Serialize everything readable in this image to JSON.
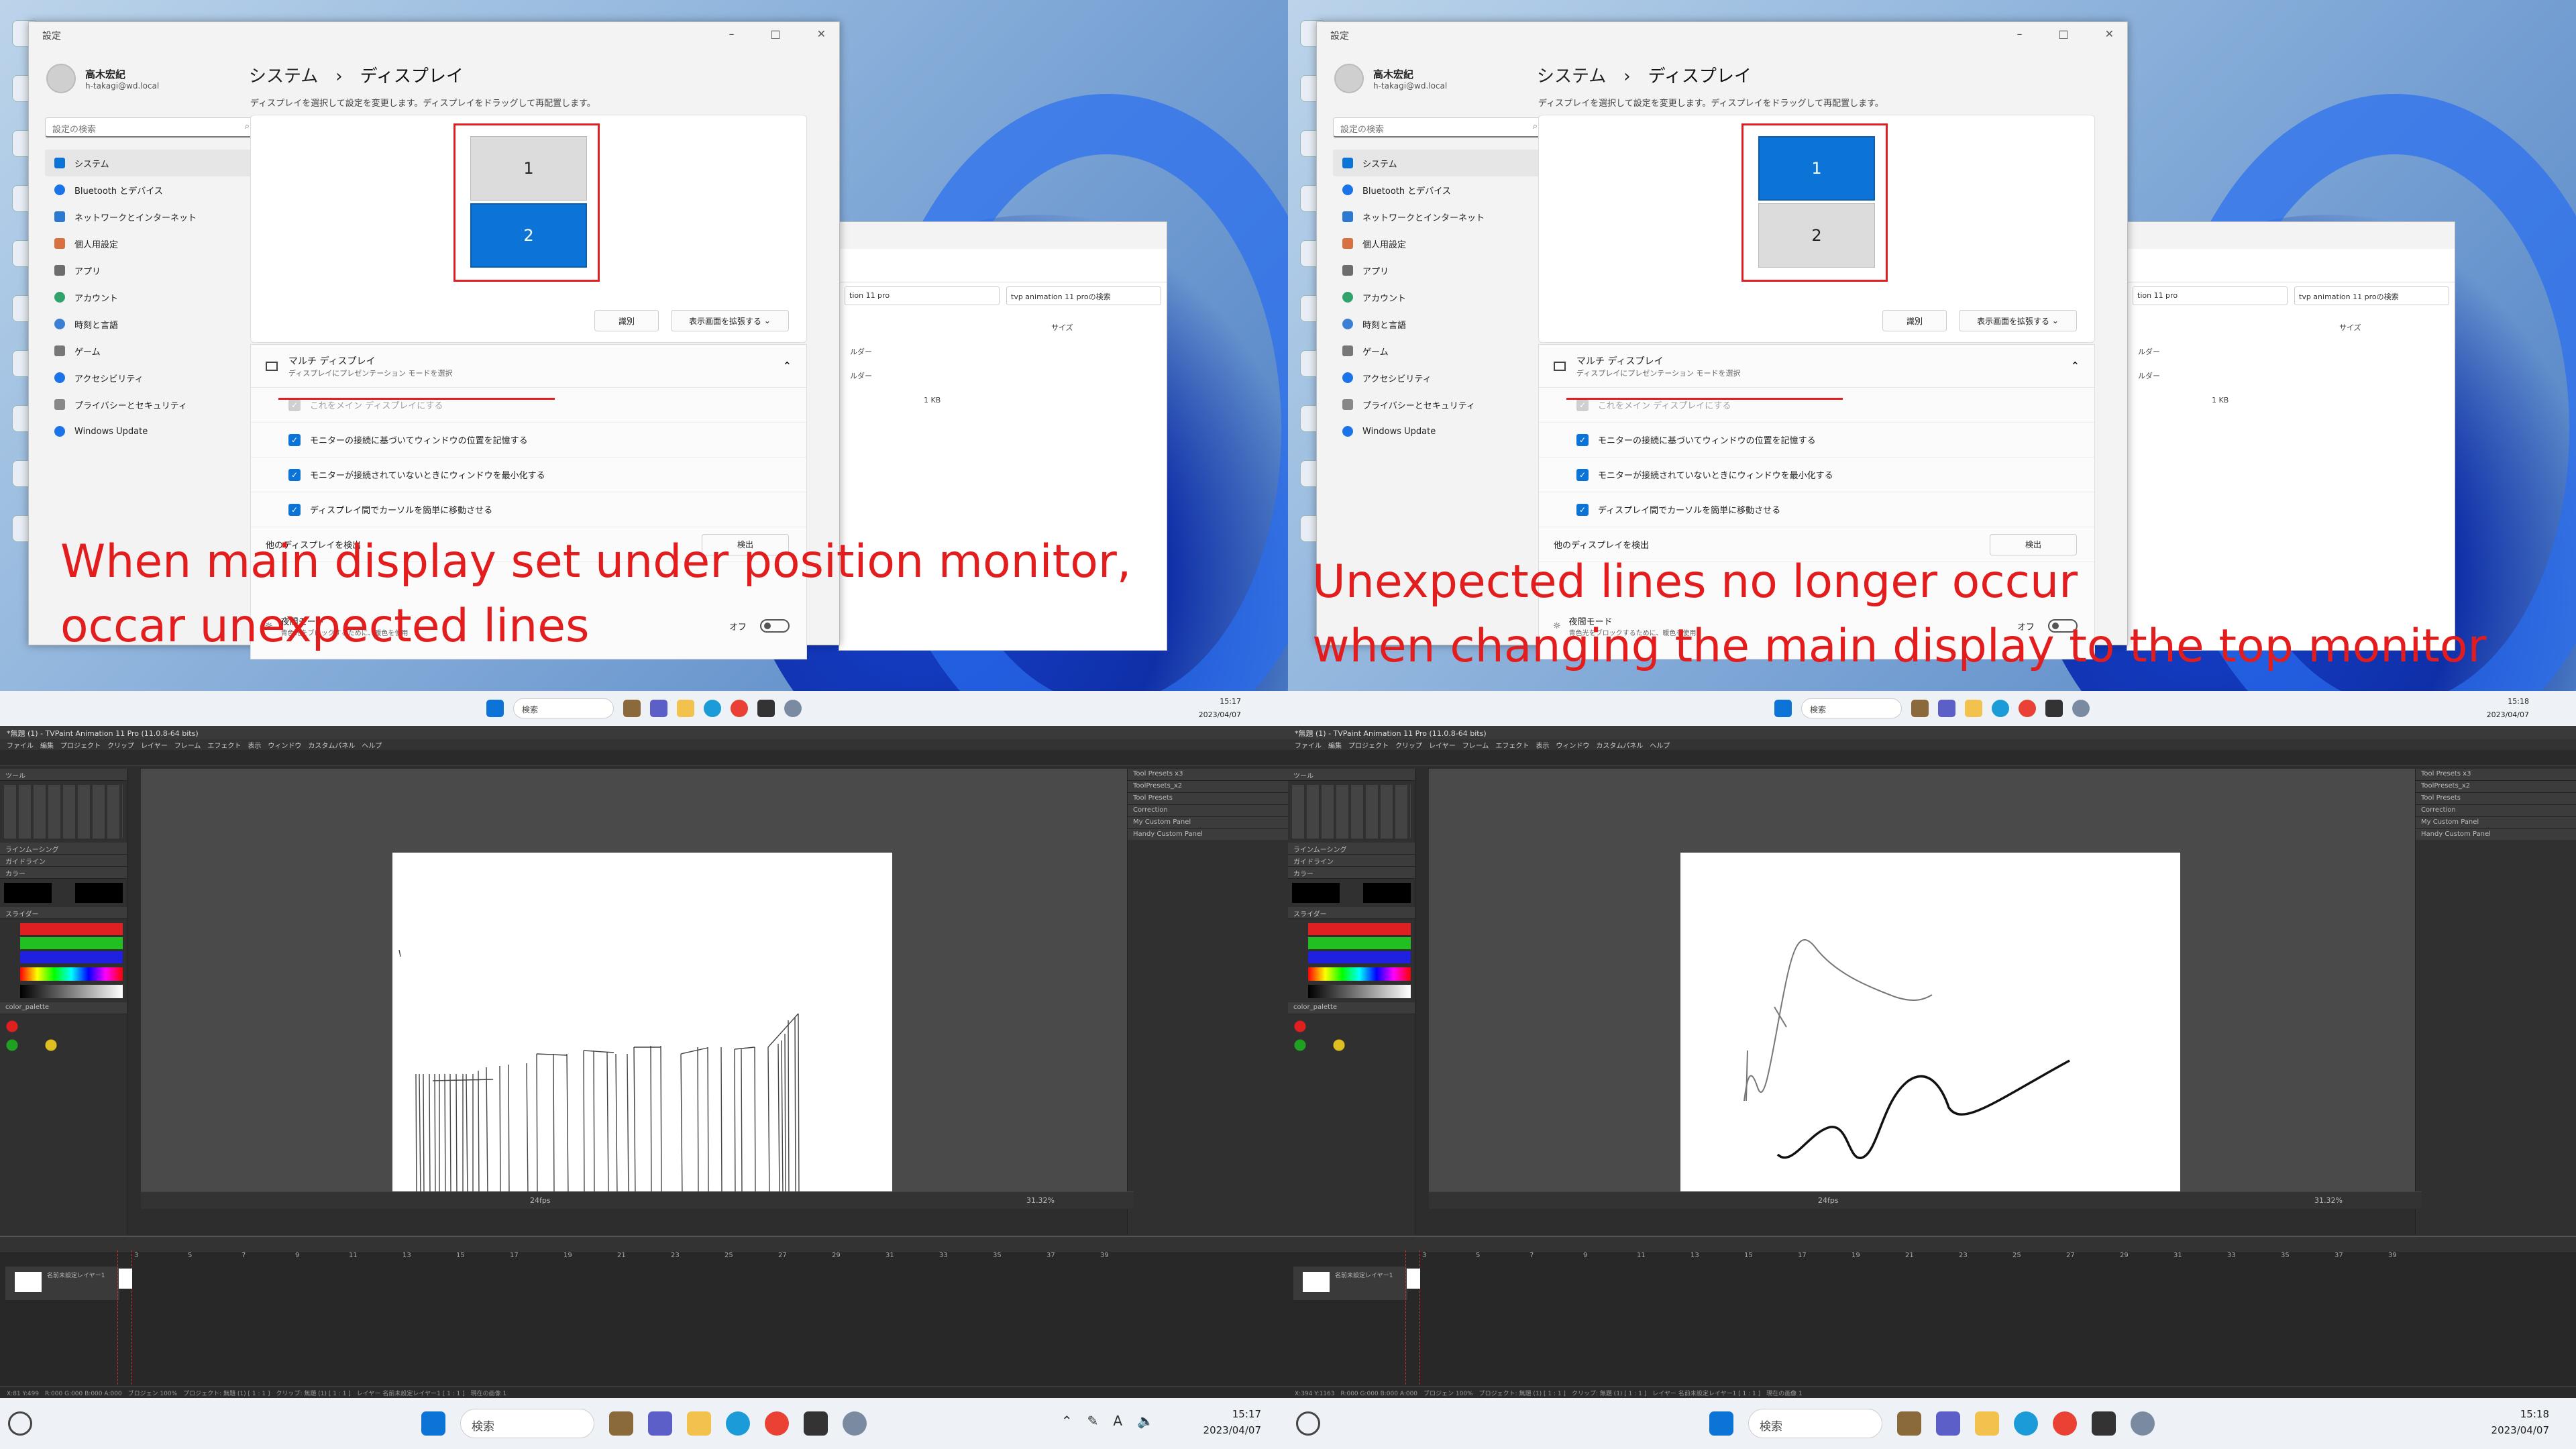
{
  "colors": {
    "accent": "#0b74d6",
    "annotation_red": "#e31d1d",
    "canvas_bg": "#ffffff",
    "app_bg": "#2d2d2d"
  },
  "panels": [
    {
      "id": "left",
      "settings": {
        "window_title": "設定",
        "user_name": "高木宏紀",
        "user_email": "h-takagi@wd.local",
        "search_placeholder": "設定の検索",
        "breadcrumb_parent": "システム",
        "breadcrumb_current": "ディスプレイ",
        "description": "ディスプレイを選択して設定を変更します。ディスプレイをドラッグして再配置します。",
        "monitor_top_label": "1",
        "monitor_bottom_label": "2",
        "selected_monitor": "bottom",
        "identify_button": "識別",
        "extend_dropdown": "表示画面を拡張する",
        "multi_title": "マルチ ディスプレイ",
        "multi_subtitle": "ディスプレイにプレゼンテーション モードを選択",
        "main_display_checkbox": "これをメイン ディスプレイにする",
        "remember_checkbox": "モニターの接続に基づいてウィンドウの位置を記憶する",
        "minimize_checkbox": "モニターが接続されていないときにウィンドウを最小化する",
        "cursor_checkbox": "ディスプレイ間でカーソルを簡単に移動させる",
        "detect_label": "他のディスプレイを検出",
        "detect_button": "検出",
        "night_title": "夜間モード",
        "night_subtitle": "青色光をブロックするために、暖色を使用",
        "night_value": "オフ",
        "nav": [
          "システム",
          "Bluetooth とデバイス",
          "ネットワークとインターネット",
          "個人用設定",
          "アプリ",
          "アカウント",
          "時刻と言語",
          "ゲーム",
          "アクセシビリティ",
          "プライバシーとセキュリティ",
          "Windows Update"
        ]
      },
      "explorer": {
        "address": "tion 11 pro",
        "search": "tvp animation 11 proの検索",
        "col_size": "サイズ",
        "rows": [
          "ルダー",
          "ルダー",
          "1 KB"
        ]
      },
      "caption_line1": "When main display set under position monitor,",
      "caption_line2": "occar unexpected lines",
      "taskbar_top": {
        "search": "検索",
        "time": "15:17",
        "date": "2023/04/07"
      },
      "tvpaint": {
        "title": "*無題 (1) - TVPaint Animation 11 Pro (11.0.8-64 bits)",
        "menu": "ファイル　編集　プロジェクト　クリップ　レイヤー　フレーム　エフェクト　表示　ウィンドウ　カスタムパネル　ヘルプ",
        "zoom": "31.32%",
        "fps": "24fps",
        "status": "X:81 Y:499　R:000 G:000 B:000 A:000　ブロジェン 100%　プロジェクト: 無題 (1) [ 1 : 1 ]　クリップ: 無題 (1) [ 1 : 1 ]　レイヤー 名前未設定レイヤー1 [ 1 : 1 ]　現在の画像 1",
        "layer_name": "名前未設定レイヤー1",
        "panel_header": "Tool Presets x3"
      },
      "taskbar_bottom": {
        "search": "検索",
        "time": "15:17",
        "date": "2023/04/07"
      }
    },
    {
      "id": "right",
      "settings": {
        "window_title": "設定",
        "user_name": "高木宏紀",
        "user_email": "h-takagi@wd.local",
        "search_placeholder": "設定の検索",
        "breadcrumb_parent": "システム",
        "breadcrumb_current": "ディスプレイ",
        "description": "ディスプレイを選択して設定を変更します。ディスプレイをドラッグして再配置します。",
        "monitor_top_label": "1",
        "monitor_bottom_label": "2",
        "selected_monitor": "top",
        "identify_button": "識別",
        "extend_dropdown": "表示画面を拡張する",
        "multi_title": "マルチ ディスプレイ",
        "multi_subtitle": "ディスプレイにプレゼンテーション モードを選択",
        "main_display_checkbox": "これをメイン ディスプレイにする",
        "remember_checkbox": "モニターの接続に基づいてウィンドウの位置を記憶する",
        "minimize_checkbox": "モニターが接続されていないときにウィンドウを最小化する",
        "cursor_checkbox": "ディスプレイ間でカーソルを簡単に移動させる",
        "detect_label": "他のディスプレイを検出",
        "detect_button": "検出",
        "night_title": "夜間モード",
        "night_subtitle": "青色光をブロックするために、暖色を使用",
        "night_value": "オフ",
        "nav": [
          "システム",
          "Bluetooth とデバイス",
          "ネットワークとインターネット",
          "個人用設定",
          "アプリ",
          "アカウント",
          "時刻と言語",
          "ゲーム",
          "アクセシビリティ",
          "プライバシーとセキュリティ",
          "Windows Update"
        ]
      },
      "explorer": {
        "address": "tion 11 pro",
        "search": "tvp animation 11 proの検索",
        "col_size": "サイズ",
        "rows": [
          "ルダー",
          "ルダー",
          "1 KB"
        ]
      },
      "caption_line1": "Unexpected lines no longer occur",
      "caption_line2": "when changing the main display to the top monitor",
      "taskbar_top": {
        "search": "検索",
        "time": "15:18",
        "date": "2023/04/07"
      },
      "tvpaint": {
        "title": "*無題 (1) - TVPaint Animation 11 Pro (11.0.8-64 bits)",
        "menu": "ファイル　編集　プロジェクト　クリップ　レイヤー　フレーム　エフェクト　表示　ウィンドウ　カスタムパネル　ヘルプ",
        "zoom": "31.32%",
        "fps": "24fps",
        "status": "X:394 Y:1163　R:000 G:000 B:000 A:000　ブロジェン 100%　プロジェクト: 無題 (1) [ 1 : 1 ]　クリップ: 無題 (1) [ 1 : 1 ]　レイヤー 名前未設定レイヤー1 [ 1 : 1 ]　現在の画像 1",
        "layer_name": "名前未設定レイヤー1",
        "panel_header": "Tool Presets x3"
      },
      "taskbar_bottom": {
        "search": "検索",
        "time": "15:18",
        "date": "2023/04/07"
      }
    }
  ]
}
